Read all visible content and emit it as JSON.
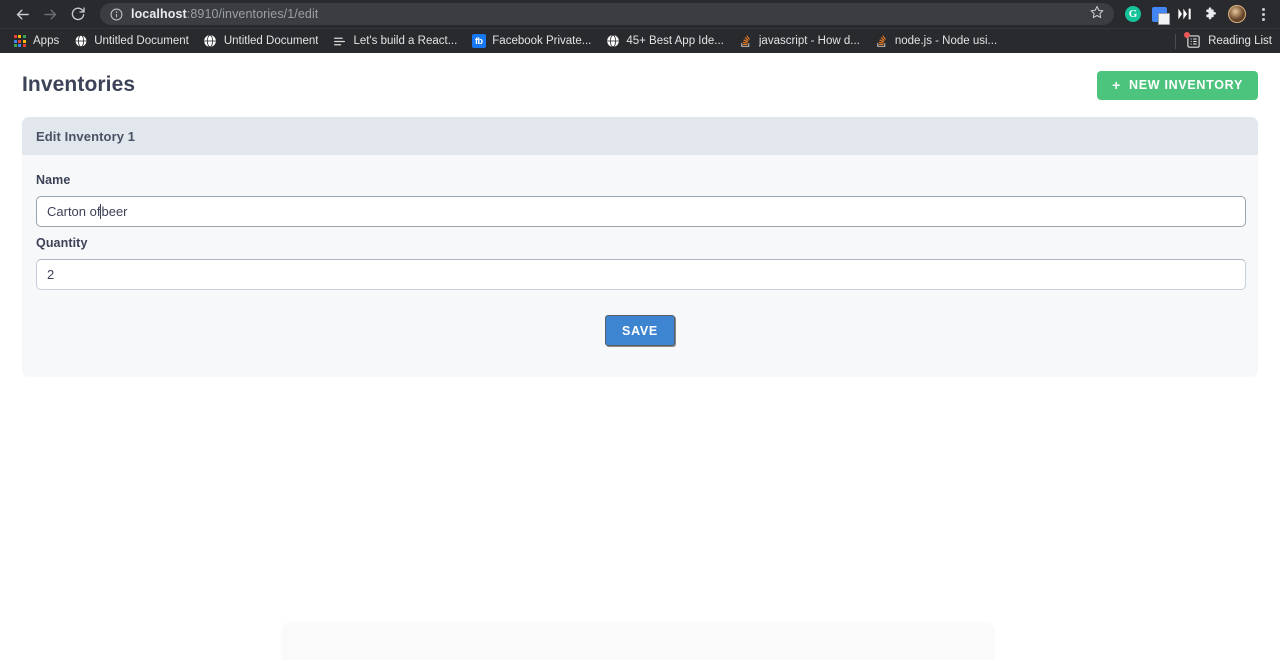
{
  "browser": {
    "nav": {
      "back_title": "Back",
      "forward_title": "Forward",
      "reload_title": "Reload"
    },
    "omnibox": {
      "info_icon": "info-circle-icon",
      "url_host": "localhost",
      "url_rest": ":8910/inventories/1/edit",
      "full_url": "localhost:8910/inventories/1/edit",
      "star_icon": "bookmark-star-icon"
    },
    "extensions": [
      {
        "name": "grammarly-extension-icon",
        "label": "G"
      },
      {
        "name": "google-translate-extension-icon",
        "label": ""
      },
      {
        "name": "medium-extension-icon",
        "label": "M"
      },
      {
        "name": "extensions-puzzle-icon",
        "label": ""
      },
      {
        "name": "profile-avatar",
        "label": ""
      },
      {
        "name": "chrome-menu-icon",
        "label": ""
      }
    ],
    "bookmarks": [
      {
        "label": "Apps",
        "favicon": "apps-grid-icon"
      },
      {
        "label": "Untitled Document",
        "favicon": "globe-icon"
      },
      {
        "label": "Untitled Document",
        "favicon": "globe-icon"
      },
      {
        "label": "Let's build a React...",
        "favicon": "document-lines-icon"
      },
      {
        "label": "Facebook Private...",
        "favicon": "facebook-icon"
      },
      {
        "label": "45+ Best App Ide...",
        "favicon": "globe-icon"
      },
      {
        "label": "javascript - How d...",
        "favicon": "stackoverflow-icon"
      },
      {
        "label": "node.js - Node usi...",
        "favicon": "stackoverflow-icon"
      }
    ],
    "reading_list": {
      "label": "Reading List",
      "icon": "reading-list-icon",
      "has_notification": true
    }
  },
  "page": {
    "title": "Inventories",
    "new_button": {
      "label": "NEW INVENTORY",
      "icon": "plus-icon",
      "color": "#4dc47d"
    },
    "card": {
      "header_title": "Edit Inventory 1",
      "fields": [
        {
          "label": "Name",
          "value_before_caret": "Carton of ",
          "value_after_caret": "beer",
          "value": "Carton of beer",
          "placeholder": "",
          "focused": true
        },
        {
          "label": "Quantity",
          "value_before_caret": "2",
          "value_after_caret": "",
          "value": "2",
          "placeholder": "",
          "focused": false
        }
      ],
      "save_button": {
        "label": "SAVE",
        "color": "#3d85d0"
      }
    }
  },
  "colors": {
    "accent_green": "#4dc47d",
    "accent_blue": "#3d85d0",
    "card_header": "#e2e6ed",
    "card_body": "#f7f8fa",
    "text_dark": "#3c4257",
    "chrome_bg": "#292a2d"
  }
}
